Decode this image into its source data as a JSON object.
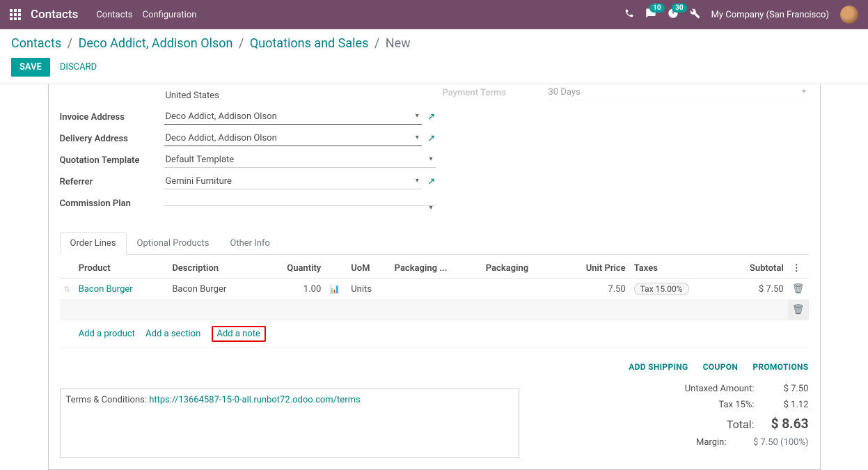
{
  "navbar": {
    "brand": "Contacts",
    "links": [
      "Contacts",
      "Configuration"
    ],
    "messages_badge": "10",
    "activities_badge": "30",
    "company": "My Company (San Francisco)"
  },
  "breadcrumb": {
    "items": [
      "Contacts",
      "Deco Addict, Addison Olson",
      "Quotations and Sales"
    ],
    "active": "New"
  },
  "buttons": {
    "save": "SAVE",
    "discard": "DISCARD"
  },
  "fields": {
    "country": "United States",
    "invoice_address_label": "Invoice Address",
    "invoice_address": "Deco Addict, Addison Olson",
    "delivery_address_label": "Delivery Address",
    "delivery_address": "Deco Addict, Addison Olson",
    "quotation_template_label": "Quotation Template",
    "quotation_template": "Default Template",
    "referrer_label": "Referrer",
    "referrer": "Gemini Furniture",
    "commission_plan_label": "Commission Plan",
    "commission_plan": "",
    "payment_terms_label": "Payment Terms",
    "payment_terms": "30 Days"
  },
  "tabs": [
    "Order Lines",
    "Optional Products",
    "Other Info"
  ],
  "table": {
    "headers": {
      "product": "Product",
      "description": "Description",
      "quantity": "Quantity",
      "uom": "UoM",
      "packaging_qty": "Packaging ...",
      "packaging": "Packaging",
      "unit_price": "Unit Price",
      "taxes": "Taxes",
      "subtotal": "Subtotal"
    },
    "rows": [
      {
        "product": "Bacon Burger",
        "description": "Bacon Burger",
        "quantity": "1.00",
        "uom": "Units",
        "unit_price": "7.50",
        "tax": "Tax 15.00%",
        "subtotal": "$ 7.50"
      }
    ],
    "actions": {
      "add_product": "Add a product",
      "add_section": "Add a section",
      "add_note": "Add a note"
    }
  },
  "promos": {
    "shipping": "ADD SHIPPING",
    "coupon": "COUPON",
    "promotions": "PROMOTIONS"
  },
  "terms": {
    "label": "Terms & Conditions: ",
    "link": "https://13664587-15-0-all.runbot72.odoo.com/terms"
  },
  "totals": {
    "untaxed_label": "Untaxed Amount:",
    "untaxed": "$ 7.50",
    "tax_label": "Tax 15%:",
    "tax": "$ 1.12",
    "total_label": "Total:",
    "total": "$ 8.63",
    "margin_label": "Margin:",
    "margin": "$ 7.50 (100%)"
  }
}
